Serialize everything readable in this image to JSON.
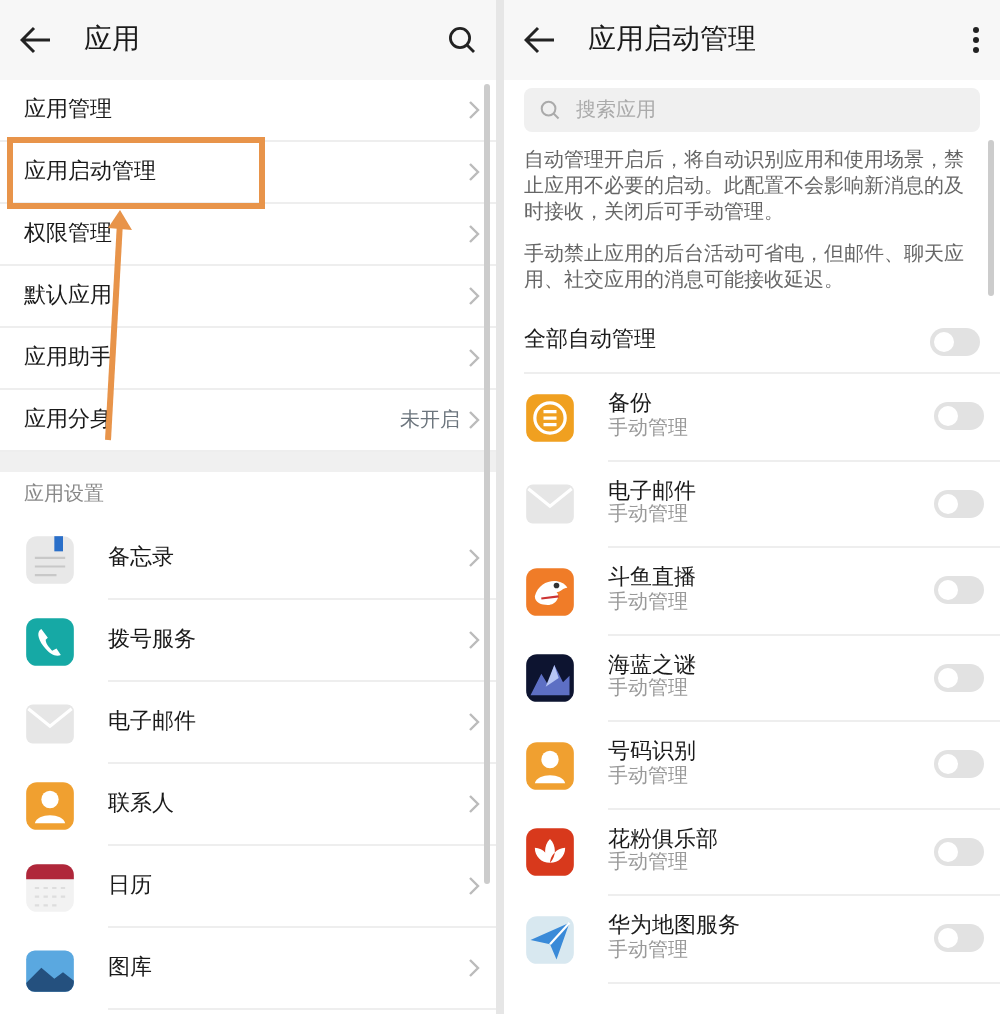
{
  "left_screen": {
    "title": "应用",
    "menu_items": [
      {
        "label": "应用管理",
        "annotated": false
      },
      {
        "label": "应用启动管理",
        "annotated": true
      },
      {
        "label": "权限管理",
        "annotated": false
      },
      {
        "label": "默认应用",
        "annotated": false
      },
      {
        "label": "应用助手",
        "annotated": false
      },
      {
        "label": "应用分身",
        "value": "未开启",
        "annotated": false
      }
    ],
    "section_title": "应用设置",
    "apps": [
      {
        "name": "备忘录"
      },
      {
        "name": "拨号服务"
      },
      {
        "name": "电子邮件"
      },
      {
        "name": "联系人"
      },
      {
        "name": "日历"
      },
      {
        "name": "图库"
      }
    ]
  },
  "right_screen": {
    "title": "应用启动管理",
    "search": {
      "placeholder": "搜索应用"
    },
    "descriptions": [
      "自动管理开启后，将自动识别应用和使用场景，禁止应用不必要的启动。此配置不会影响新消息的及时接收，关闭后可手动管理。",
      "手动禁止应用的后台活动可省电，但邮件、聊天应用、社交应用的消息可能接收延迟。"
    ],
    "auto_manage_all": {
      "label": "全部自动管理",
      "on": false
    },
    "apps": [
      {
        "name": "备份",
        "status": "手动管理",
        "on": false
      },
      {
        "name": "电子邮件",
        "status": "手动管理",
        "on": false
      },
      {
        "name": "斗鱼直播",
        "status": "手动管理",
        "on": false
      },
      {
        "name": "海蓝之谜",
        "status": "手动管理",
        "on": false
      },
      {
        "name": "号码识别",
        "status": "手动管理",
        "on": false
      },
      {
        "name": "花粉俱乐部",
        "status": "手动管理",
        "on": false
      },
      {
        "name": "华为地图服务",
        "status": "手动管理",
        "on": false
      }
    ]
  }
}
